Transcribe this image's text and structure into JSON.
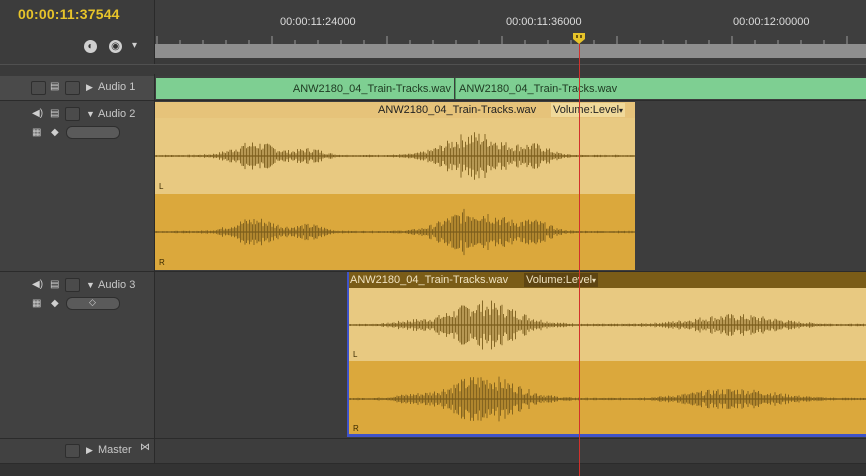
{
  "header": {
    "timecode": "00:00:11:37544"
  },
  "ruler": {
    "labels": [
      "00:00:11:24000",
      "00:00:11:36000",
      "00:00:12:00000"
    ]
  },
  "tracks": [
    {
      "name": "Audio 1",
      "clips": [
        "ANW2180_04_Train-Tracks.wav",
        "ANW2180_04_Train-Tracks.wav"
      ]
    },
    {
      "name": "Audio 2",
      "clip": "ANW2180_04_Train-Tracks.wav",
      "param": "Volume:Level",
      "left_label": "L",
      "right_label": "R"
    },
    {
      "name": "Audio 3",
      "clip": "ANW2180_04_Train-Tracks.wav",
      "param": "Volume:Level",
      "left_label": "L",
      "right_label": "R"
    },
    {
      "name": "Master"
    }
  ],
  "colors": {
    "timecode": "#e7c42a",
    "audio1_clip": "#7ecf92",
    "clip_light": "#e8c981",
    "clip_dark": "#dba83c",
    "waveform": "#7b5d1c",
    "playhead": "#d2312c",
    "selection": "#3f53c8"
  },
  "icons": {
    "hdr_a": "snap-icon",
    "hdr_b": "marker-icon",
    "hdr_c": "settings-icon",
    "speaker": "speaker-icon",
    "meter": "meter-icon",
    "keyframe": "keyframe-icon"
  }
}
